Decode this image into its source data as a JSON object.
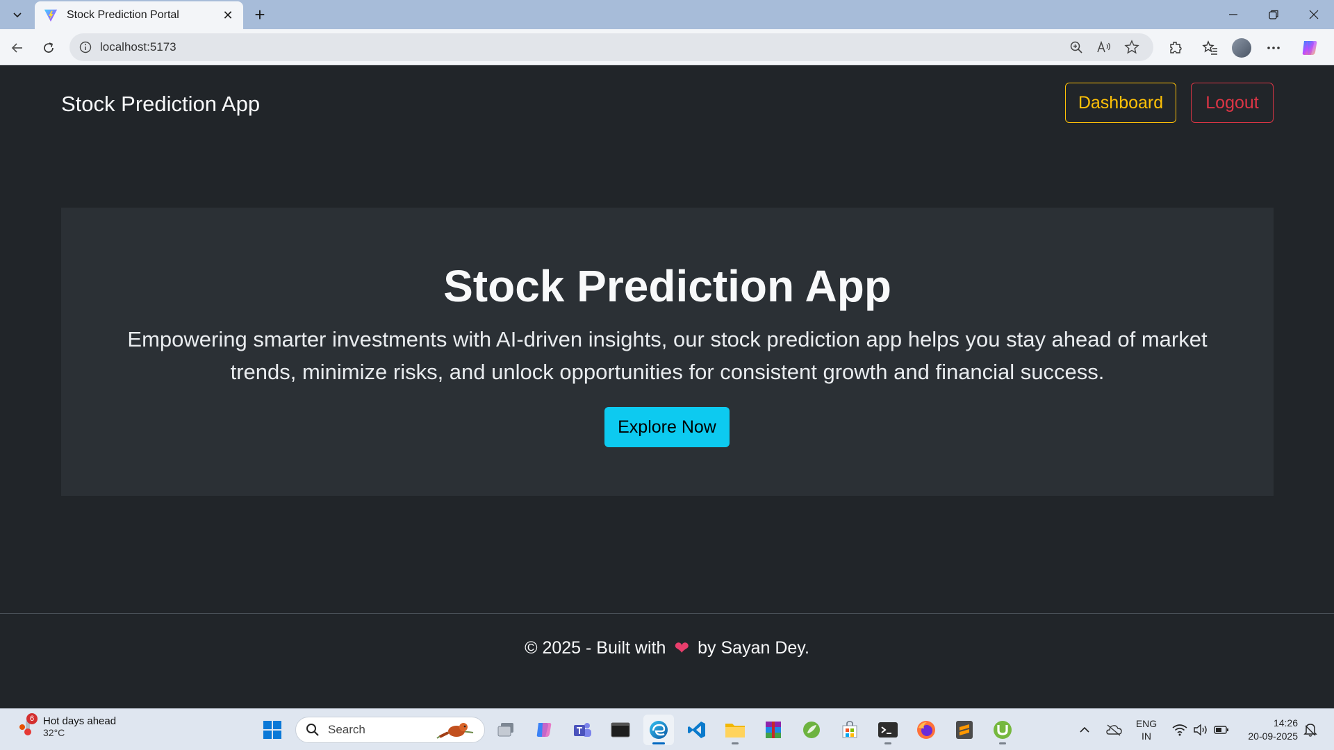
{
  "browser": {
    "tab_title": "Stock Prediction Portal",
    "tab_close": "✕",
    "new_tab": "+",
    "url": "localhost:5173"
  },
  "navbar": {
    "brand": "Stock Prediction App",
    "dashboard_label": "Dashboard",
    "logout_label": "Logout"
  },
  "hero": {
    "title": "Stock Prediction App",
    "description": "Empowering smarter investments with AI-driven insights, our stock prediction app helps you stay ahead of market trends, minimize risks, and unlock opportunities for consistent growth and financial success.",
    "cta_label": "Explore Now"
  },
  "footer": {
    "prefix": "© 2025 - Built with",
    "heart": "❤",
    "suffix": "by Sayan Dey."
  },
  "taskbar": {
    "weather_title": "Hot days ahead",
    "weather_temp": "32°C",
    "weather_badge": "6",
    "search_label": "Search",
    "lang_line1": "ENG",
    "lang_line2": "IN",
    "time": "14:26",
    "date": "20-09-2025"
  },
  "colors": {
    "page_bg": "#212529",
    "hero_bg": "#2b3035",
    "dashboard": "#ffc107",
    "logout": "#dc3545",
    "explore": "#0dcaf0"
  }
}
